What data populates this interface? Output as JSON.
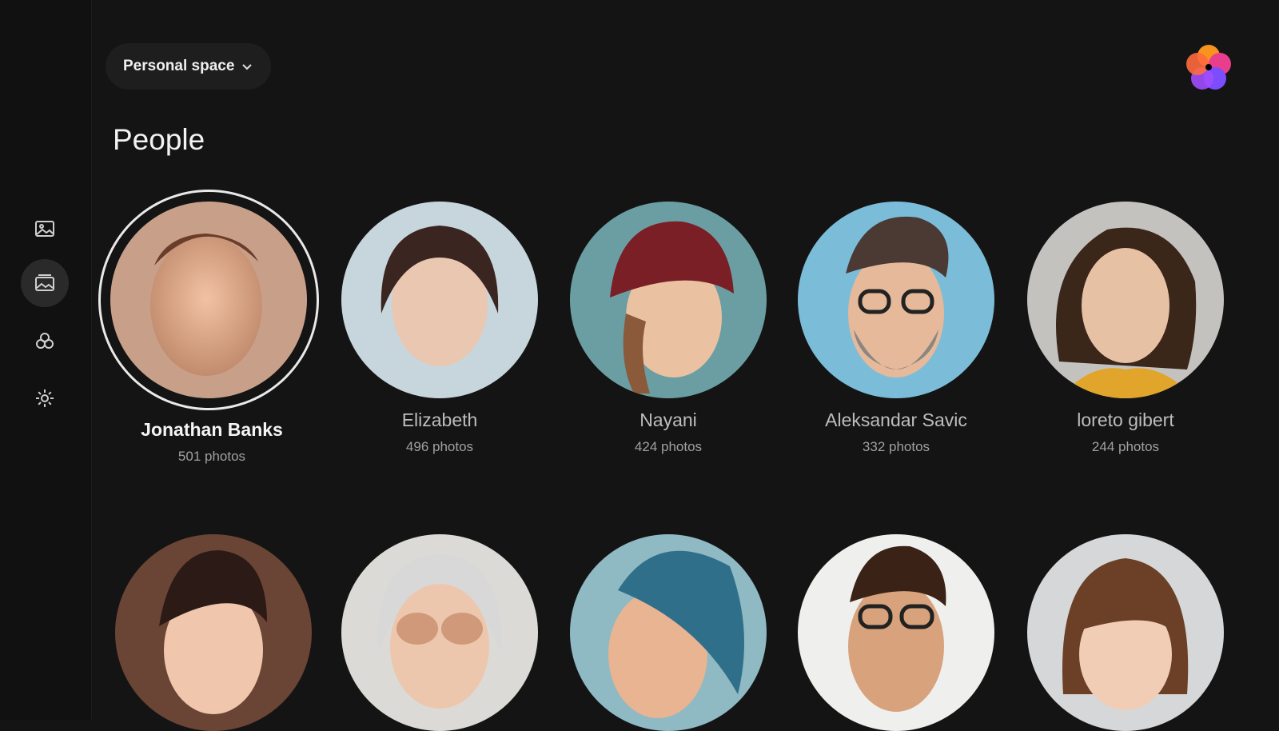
{
  "header": {
    "space_label": "Personal space",
    "page_title": "People"
  },
  "sidebar": {
    "items": [
      {
        "icon": "photos-icon",
        "active": false
      },
      {
        "icon": "albums-icon",
        "active": true
      },
      {
        "icon": "people-icon",
        "active": false
      },
      {
        "icon": "settings-icon",
        "active": false
      }
    ]
  },
  "people": [
    {
      "name": "Jonathan Banks",
      "count": "501 photos",
      "selected": true
    },
    {
      "name": "Elizabeth",
      "count": "496 photos",
      "selected": false
    },
    {
      "name": "Nayani",
      "count": "424 photos",
      "selected": false
    },
    {
      "name": "Aleksandar Savic",
      "count": "332 photos",
      "selected": false
    },
    {
      "name": "loreto gibert",
      "count": "244 photos",
      "selected": false
    },
    {
      "name": "",
      "count": "",
      "selected": false
    },
    {
      "name": "",
      "count": "",
      "selected": false
    },
    {
      "name": "",
      "count": "",
      "selected": false
    },
    {
      "name": "",
      "count": "",
      "selected": false
    },
    {
      "name": "",
      "count": "",
      "selected": false
    }
  ],
  "colors": {
    "background": "#141414",
    "sidebar": "#111111",
    "accent_orange": "#f7931e",
    "accent_pink": "#e83e8c",
    "accent_purple": "#7b4dff"
  }
}
